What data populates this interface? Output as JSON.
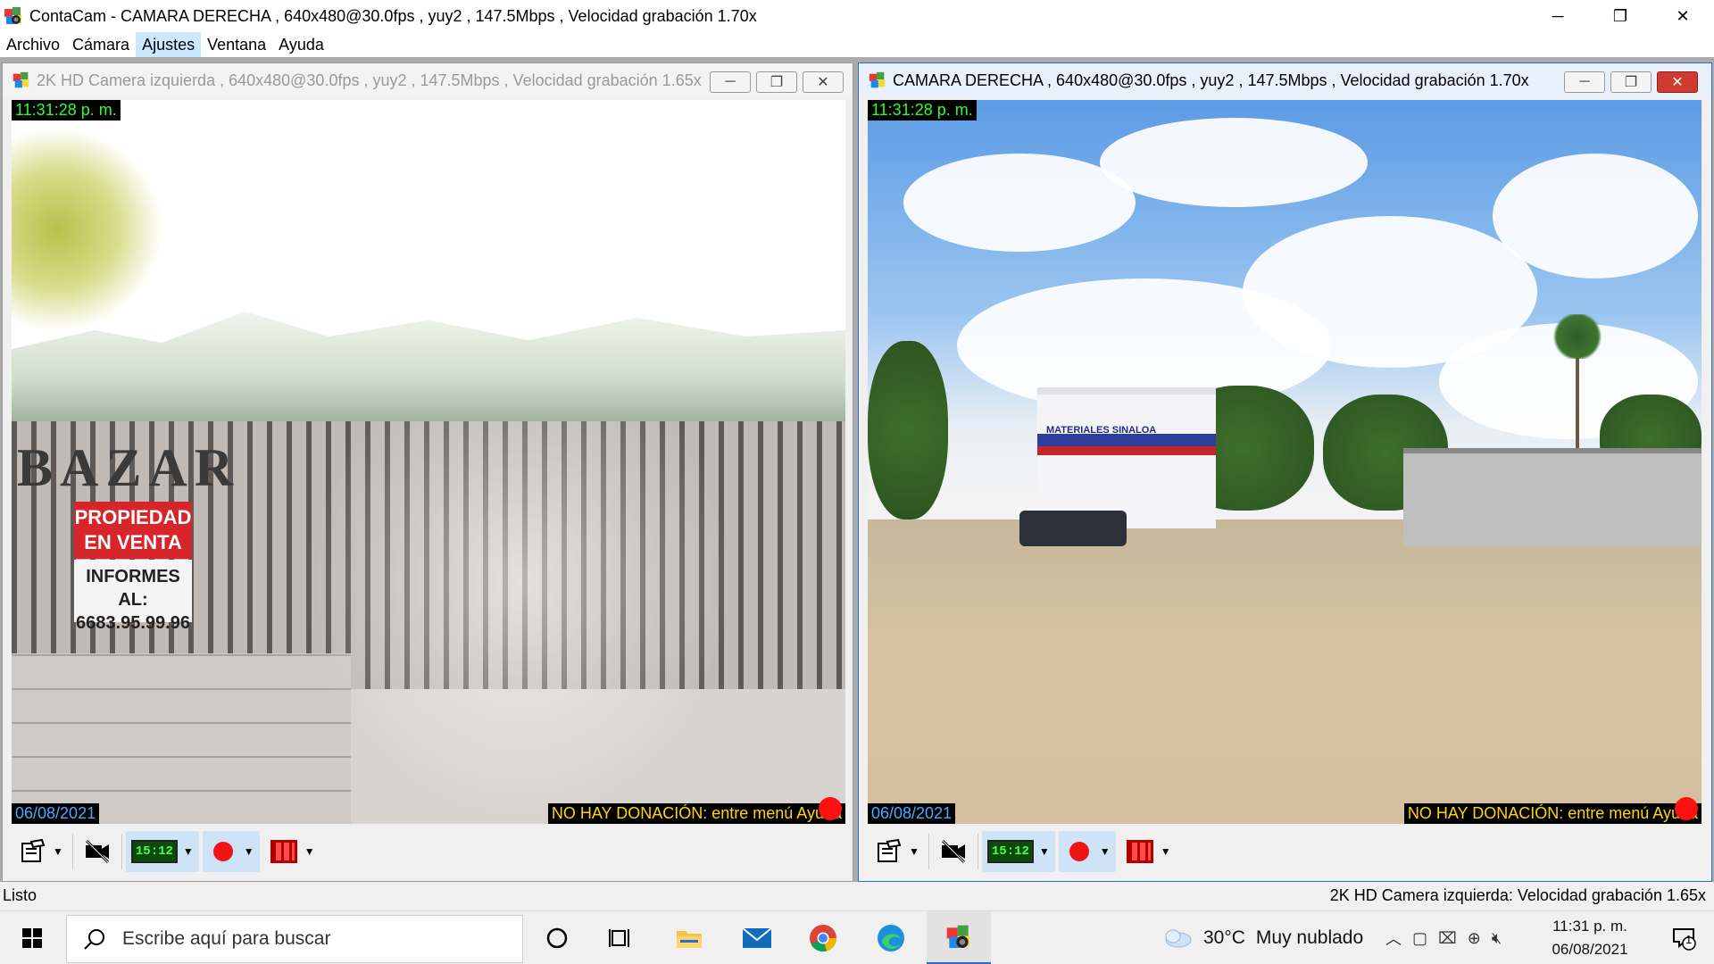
{
  "app": {
    "title": "ContaCam - CAMARA DERECHA , 640x480@30.0fps , yuy2 , 147.5Mbps , Velocidad grabación 1.70x",
    "controls": {
      "minimize": "─",
      "maximize": "❐",
      "close": "✕"
    }
  },
  "menu": {
    "items": [
      "Archivo",
      "Cámara",
      "Ajustes",
      "Ventana",
      "Ayuda"
    ],
    "active_index": 2
  },
  "windows": {
    "left": {
      "title": "2K HD Camera izquierda , 640x480@30.0fps , yuy2 , 147.5Mbps , Velocidad grabación 1.65x",
      "active": false,
      "overlay_time": "11:31:28 p. m.",
      "overlay_date": "06/08/2021",
      "overlay_donation": "NO HAY DONACIÓN: entre menú Ayuda",
      "scene": {
        "bazar_sign": "BAZAR",
        "red_sign": "PROPIEDAD EN VENTA",
        "white_sign_line1": "INFORMES AL:",
        "white_sign_line2": "6683.95.99.96"
      },
      "toolbar": {
        "clock_display": "15:12"
      }
    },
    "right": {
      "title": "CAMARA DERECHA , 640x480@30.0fps , yuy2 , 147.5Mbps , Velocidad grabación 1.70x",
      "active": true,
      "overlay_time": "11:31:28 p. m.",
      "overlay_date": "06/08/2021",
      "overlay_donation": "NO HAY DONACIÓN: entre menú Ayuda",
      "scene": {
        "building_sign": "MATERIALES SINALOA"
      },
      "toolbar": {
        "clock_display": "15:12"
      }
    }
  },
  "status": {
    "left": "Listo",
    "right": "2K HD Camera izquierda: Velocidad grabación 1.65x"
  },
  "taskbar": {
    "search_placeholder": "Escribe aquí para buscar",
    "weather_temp": "30°C",
    "weather_text": "Muy nublado",
    "clock_time": "11:31 p. m.",
    "clock_date": "06/08/2021",
    "notification_count": "1"
  },
  "colors": {
    "accent": "#2f6bd0",
    "overlay_time_text": "#2cff2c",
    "overlay_date_text": "#4aa8ff",
    "overlay_donation_text": "#ffd700",
    "record": "#ff1010"
  }
}
